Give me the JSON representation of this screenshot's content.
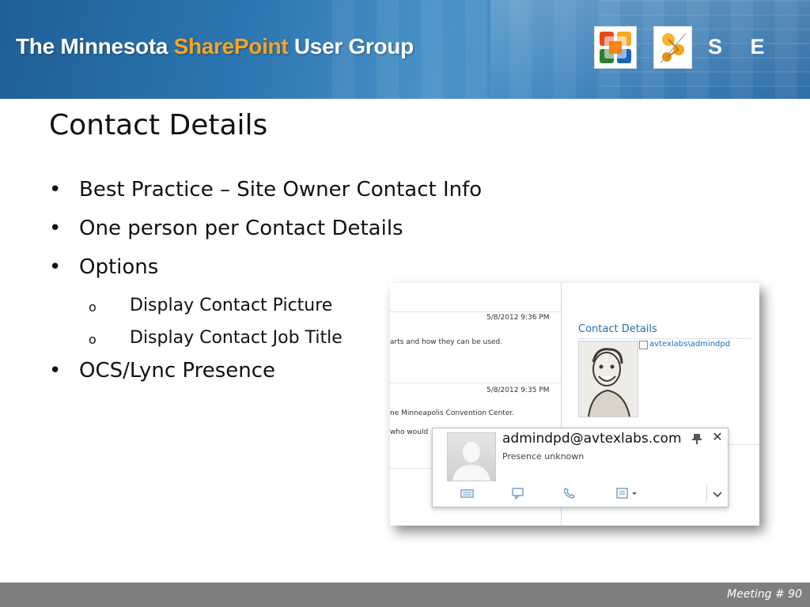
{
  "header": {
    "brand_part1": "The Minnesota ",
    "brand_accent": "SharePoint",
    "brand_part2": " User Group",
    "letters": "S E",
    "icons": [
      "office-logo-icon",
      "sharepoint-logo-icon"
    ],
    "colors": {
      "banner": "#2b76b0",
      "accent": "#f5a623"
    }
  },
  "slide": {
    "title": "Contact Details",
    "bullets": [
      {
        "text": "Best Practice – Site Owner Contact Info",
        "marker": "•"
      },
      {
        "text": "One person per Contact Details",
        "marker": "•"
      },
      {
        "text": "Options",
        "marker": "•"
      },
      {
        "text": "Display Contact Picture",
        "marker": "o"
      },
      {
        "text": "Display Contact Job Title",
        "marker": "o"
      },
      {
        "text": "OCS/Lync Presence",
        "marker": "•"
      }
    ]
  },
  "screenshot": {
    "timestamps": [
      "5/8/2012 9:36 PM",
      "5/8/2012 9:35 PM"
    ],
    "fragments": [
      "arts and how they can be used.",
      "ne Minneapolis Convention Center.",
      "who would"
    ],
    "contact_details_title": "Contact Details",
    "contact_user": "avtexlabs\\admindpd",
    "presence_card": {
      "email": "admindpd@avtexlabs.com",
      "status": "Presence unknown",
      "toolbar_icons": [
        "email-icon",
        "chat-icon",
        "phone-icon",
        "contact-card-icon"
      ]
    }
  },
  "footer": {
    "label": "Meeting # 90",
    "color": "#7f7f7f"
  }
}
